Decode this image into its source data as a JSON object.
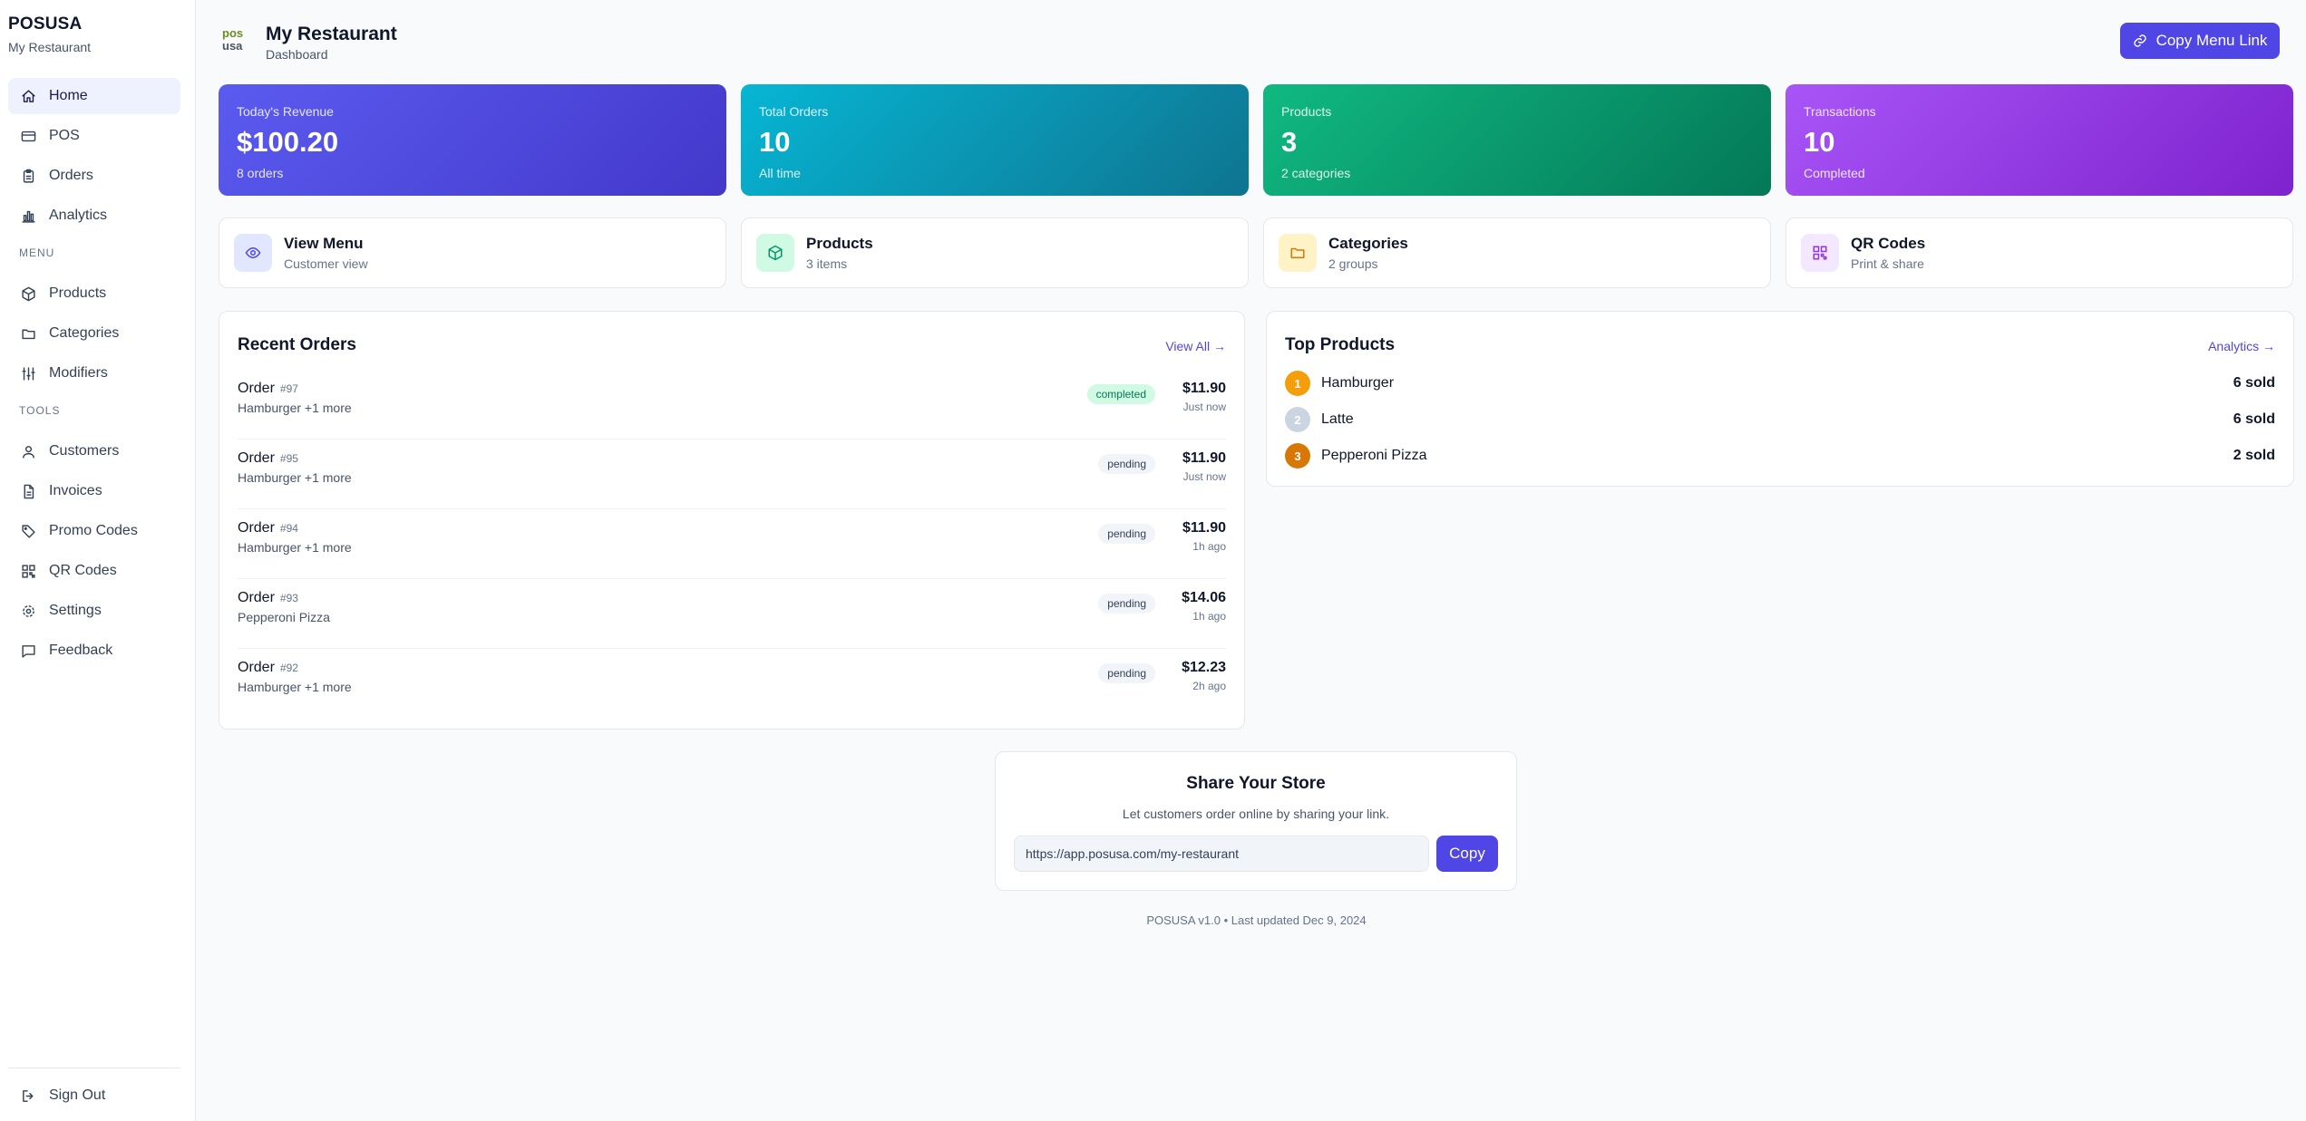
{
  "sidebar": {
    "brand": "POSUSA",
    "store": "My Restaurant",
    "main_items": [
      {
        "label": "Home",
        "icon": "home-icon"
      },
      {
        "label": "POS",
        "icon": "credit-card-icon"
      },
      {
        "label": "Orders",
        "icon": "clipboard-icon"
      },
      {
        "label": "Analytics",
        "icon": "bar-chart-icon"
      }
    ],
    "menu_section": "MENU",
    "menu_items": [
      {
        "label": "Products",
        "icon": "box-icon"
      },
      {
        "label": "Categories",
        "icon": "folder-icon"
      },
      {
        "label": "Modifiers",
        "icon": "sliders-icon"
      }
    ],
    "tools_section": "TOOLS",
    "tools_items": [
      {
        "label": "Customers",
        "icon": "users-icon"
      },
      {
        "label": "Invoices",
        "icon": "file-icon"
      },
      {
        "label": "Promo Codes",
        "icon": "tag-icon"
      },
      {
        "label": "QR Codes",
        "icon": "qr-code-icon"
      },
      {
        "label": "Settings",
        "icon": "gear-icon"
      },
      {
        "label": "Feedback",
        "icon": "message-icon"
      }
    ],
    "signout": "Sign Out"
  },
  "header": {
    "logo_line1": "pos",
    "logo_line2": "usa",
    "title": "My Restaurant",
    "subtitle": "Dashboard",
    "copy_menu_label": "Copy Menu Link"
  },
  "stats": [
    {
      "label": "Today's Revenue",
      "value": "$100.20",
      "sub": "8 orders"
    },
    {
      "label": "Total Orders",
      "value": "10",
      "sub": "All time"
    },
    {
      "label": "Products",
      "value": "3",
      "sub": "2 categories"
    },
    {
      "label": "Transactions",
      "value": "10",
      "sub": "Completed"
    }
  ],
  "quick_links": [
    {
      "title": "View Menu",
      "sub": "Customer view",
      "icon": "eye-icon"
    },
    {
      "title": "Products",
      "sub": "3 items",
      "icon": "box-icon"
    },
    {
      "title": "Categories",
      "sub": "2 groups",
      "icon": "folder-icon"
    },
    {
      "title": "QR Codes",
      "sub": "Print & share",
      "icon": "qr-code-icon"
    }
  ],
  "recent_orders": {
    "title": "Recent Orders",
    "view_all": "View All →",
    "orders": [
      {
        "name": "Order",
        "number": "#97",
        "items": "Hamburger +1 more",
        "status": "completed",
        "amount": "$11.90",
        "time": "Just now"
      },
      {
        "name": "Order",
        "number": "#95",
        "items": "Hamburger +1 more",
        "status": "pending",
        "amount": "$11.90",
        "time": "Just now"
      },
      {
        "name": "Order",
        "number": "#94",
        "items": "Hamburger +1 more",
        "status": "pending",
        "amount": "$11.90",
        "time": "1h ago"
      },
      {
        "name": "Order",
        "number": "#93",
        "items": "Pepperoni Pizza",
        "status": "pending",
        "amount": "$14.06",
        "time": "1h ago"
      },
      {
        "name": "Order",
        "number": "#92",
        "items": "Hamburger +1 more",
        "status": "pending",
        "amount": "$12.23",
        "time": "2h ago"
      }
    ]
  },
  "top_products": {
    "title": "Top Products",
    "analytics_link": "Analytics →",
    "items": [
      {
        "rank": "1",
        "name": "Hamburger",
        "sold": "6 sold",
        "color": "#f59e0b"
      },
      {
        "rank": "2",
        "name": "Latte",
        "sold": "6 sold",
        "color": "#cbd5e1"
      },
      {
        "rank": "3",
        "name": "Pepperoni Pizza",
        "sold": "2 sold",
        "color": "#d97706"
      }
    ]
  },
  "share": {
    "title": "Share Your Store",
    "subtitle": "Let customers order online by sharing your link.",
    "url": "https://app.posusa.com/my-restaurant",
    "copy_label": "Copy"
  },
  "footer": "POSUSA v1.0 • Last updated Dec 9, 2024",
  "colors": {
    "accent": "#4f46e5",
    "stat_revenue": "#4f46e5",
    "stat_orders": "#0891b2",
    "stat_products": "#059669",
    "stat_transactions": "#7e22ce"
  }
}
